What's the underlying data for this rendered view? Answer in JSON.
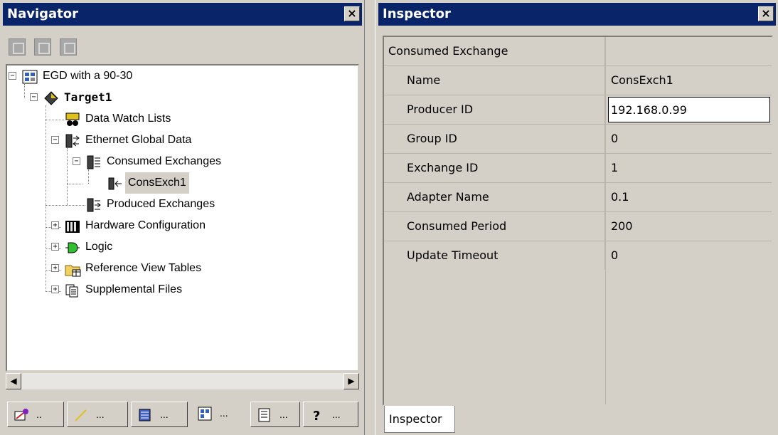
{
  "navigator": {
    "title": "Navigator",
    "close_label": "×",
    "toolbar": [
      "grid-view-icon",
      "properties-icon",
      "layout-icon"
    ],
    "tree": {
      "root": "EGD with a 90-30",
      "target": "Target1",
      "data_watch": "Data Watch Lists",
      "egd": "Ethernet Global Data",
      "consumed": "Consumed Exchanges",
      "consexch": "ConsExch1",
      "produced": "Produced Exchanges",
      "hardware": "Hardware Configuration",
      "logic": "Logic",
      "refview": "Reference View Tables",
      "supplemental": "Supplemental Files"
    },
    "tabs": [
      "..",
      "...",
      "...",
      "...",
      "...",
      "..."
    ]
  },
  "inspector": {
    "title": "Inspector",
    "close_label": "×",
    "header": "Consumed Exchange",
    "props": [
      {
        "name": "Name",
        "value": "ConsExch1"
      },
      {
        "name": "Producer ID",
        "value": "192.168.0.99"
      },
      {
        "name": "Group ID",
        "value": "0"
      },
      {
        "name": "Exchange ID",
        "value": "1"
      },
      {
        "name": "Adapter Name",
        "value": "0.1"
      },
      {
        "name": "Consumed Period",
        "value": "200"
      },
      {
        "name": "Update Timeout",
        "value": "0"
      }
    ],
    "tab": "Inspector"
  },
  "colors": {
    "titlebar": "#0a246a",
    "face": "#d4d0c8"
  }
}
